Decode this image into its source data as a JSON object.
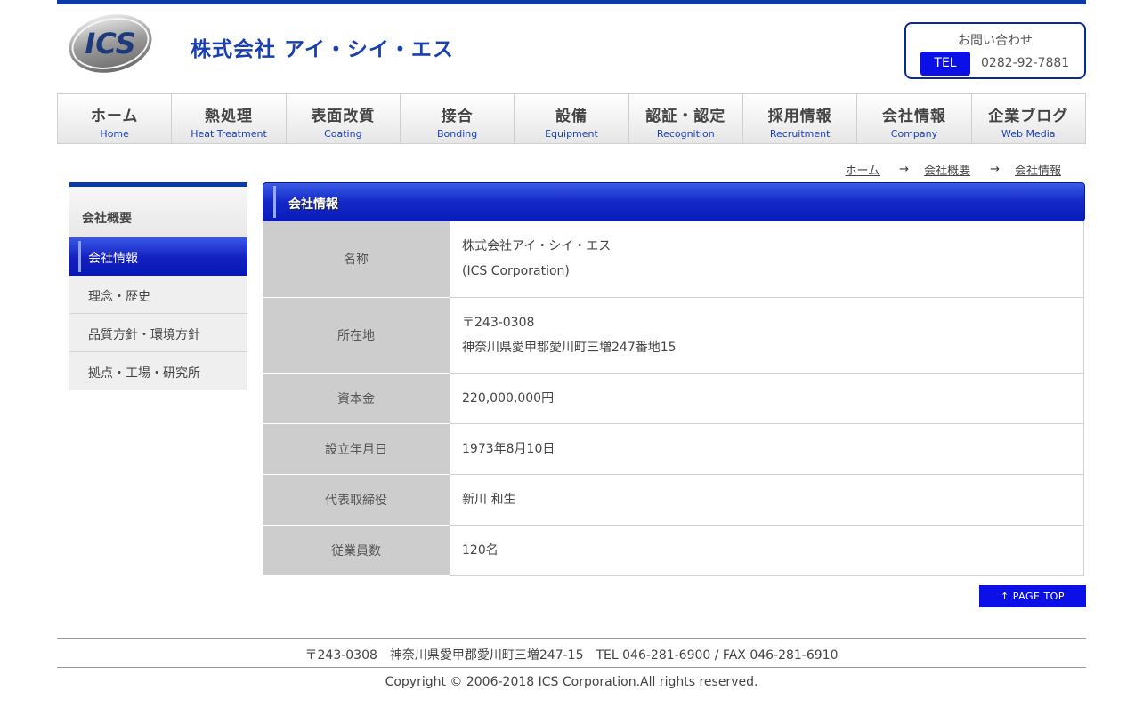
{
  "header": {
    "logo_text": "ICS",
    "company_name": "株式会社 アイ・シイ・エス",
    "contact": {
      "title": "お問い合わせ",
      "tel_label": "TEL",
      "tel_number": "0282-92-7881"
    }
  },
  "nav": [
    {
      "jp": "ホーム",
      "en": "Home"
    },
    {
      "jp": "熱処理",
      "en": "Heat Treatment"
    },
    {
      "jp": "表面改質",
      "en": "Coating"
    },
    {
      "jp": "接合",
      "en": "Bonding"
    },
    {
      "jp": "設備",
      "en": "Equipment"
    },
    {
      "jp": "認証・認定",
      "en": "Recognition"
    },
    {
      "jp": "採用情報",
      "en": "Recruitment"
    },
    {
      "jp": "会社情報",
      "en": "Company"
    },
    {
      "jp": "企業ブログ",
      "en": "Web Media"
    }
  ],
  "breadcrumb": [
    "ホーム",
    "会社概要",
    "会社情報"
  ],
  "sidebar": {
    "heading": "会社概要",
    "items": [
      {
        "label": "会社情報",
        "active": true
      },
      {
        "label": "理念・歴史"
      },
      {
        "label": "品質方針・環境方針"
      },
      {
        "label": "拠点・工場・研究所"
      }
    ]
  },
  "main": {
    "title": "会社情報",
    "rows": [
      {
        "label": "名称",
        "lines": [
          "株式会社アイ・シイ・エス",
          "(ICS Corporation)"
        ]
      },
      {
        "label": "所在地",
        "lines": [
          "〒243-0308",
          "神奈川県愛甲郡愛川町三増247番地15"
        ]
      },
      {
        "label": "資本金",
        "lines": [
          "220,000,000円"
        ]
      },
      {
        "label": "設立年月日",
        "lines": [
          "1973年8月10日"
        ]
      },
      {
        "label": "代表取締役",
        "lines": [
          "新川 和生"
        ]
      },
      {
        "label": "従業員数",
        "lines": [
          "120名"
        ]
      }
    ]
  },
  "page_top": "PAGE TOP",
  "footer": {
    "address": "〒243-0308　神奈川県愛甲郡愛川町三増247-15　TEL 046-281-6900 / FAX 046-281-6910",
    "copyright": "Copyright © 2006-2018 ICS Corporation.All rights reserved."
  },
  "colors": {
    "brand_blue": "#0c3aa8",
    "accent_blue": "#0b10e6"
  }
}
